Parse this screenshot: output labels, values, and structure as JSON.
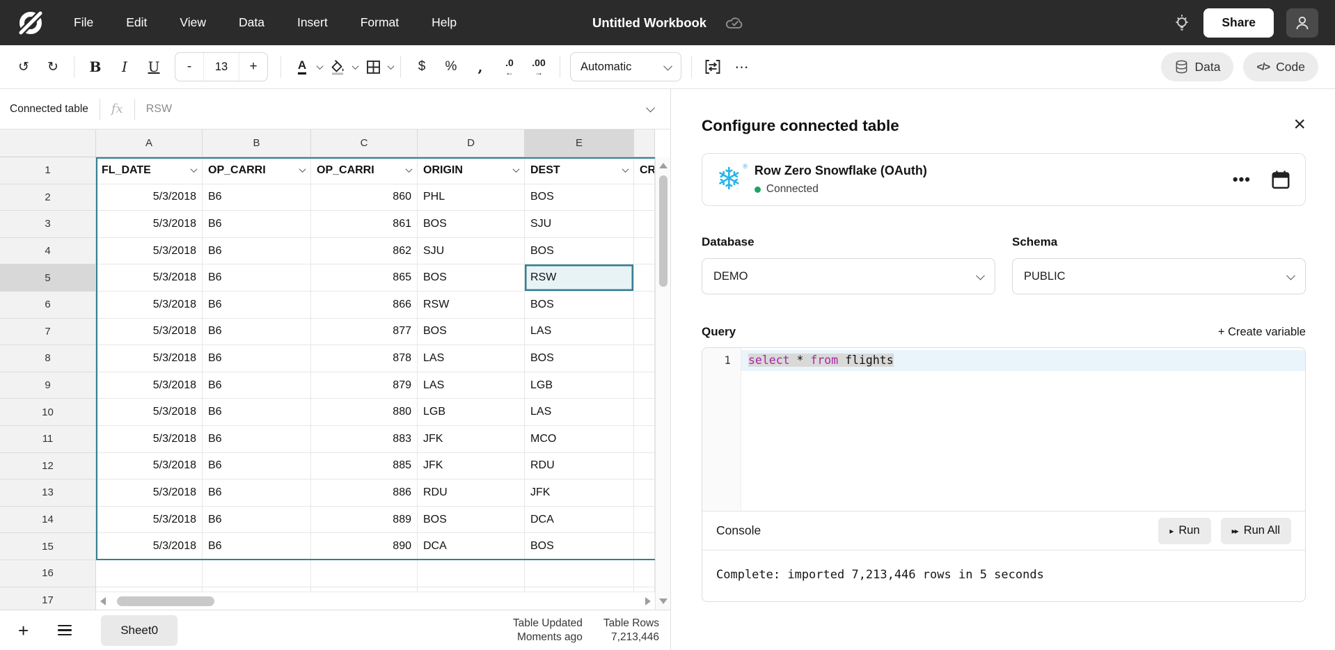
{
  "colors": {
    "topbar": "#2b2b2b",
    "accent_teal": "#337f90",
    "selected_cell_fill": "#e8f3f6",
    "snowflake_blue": "#29b5e8",
    "connected_green": "#1fa463",
    "keyword_purple": "#a626a4"
  },
  "menubar": {
    "items": [
      "File",
      "Edit",
      "View",
      "Data",
      "Insert",
      "Format",
      "Help"
    ],
    "title": "Untitled Workbook",
    "share_label": "Share"
  },
  "toolbar": {
    "undo": "↺",
    "redo": "↻",
    "bold": "B",
    "italic": "I",
    "underline": "U",
    "size_minus": "-",
    "font_size": "13",
    "size_plus": "+",
    "text_color": "A",
    "currency": "$",
    "percent": "%",
    "comma": ",",
    "dec_decrease": ".0",
    "dec_decrease_arrow": "←",
    "dec_increase": ".00",
    "dec_increase_arrow": "→",
    "number_format": "Automatic",
    "more": "⋯",
    "data_label": "Data",
    "code_glyph": "</>",
    "code_label": "Code"
  },
  "formula_bar": {
    "name_box": "Connected table",
    "fx": "fx",
    "value": "RSW"
  },
  "grid": {
    "column_letters": [
      "A",
      "B",
      "C",
      "D",
      "E",
      ""
    ],
    "header_row": [
      "FL_DATE",
      "OP_CARRI",
      "OP_CARRI",
      "ORIGIN",
      "DEST",
      "CR"
    ],
    "row_numbers": [
      "1",
      "2",
      "3",
      "4",
      "5",
      "6",
      "7",
      "8",
      "9",
      "10",
      "11",
      "12",
      "13",
      "14",
      "15",
      "16",
      "17"
    ],
    "rows": [
      [
        "5/3/2018",
        "B6",
        "860",
        "PHL",
        "BOS"
      ],
      [
        "5/3/2018",
        "B6",
        "861",
        "BOS",
        "SJU"
      ],
      [
        "5/3/2018",
        "B6",
        "862",
        "SJU",
        "BOS"
      ],
      [
        "5/3/2018",
        "B6",
        "865",
        "BOS",
        "RSW"
      ],
      [
        "5/3/2018",
        "B6",
        "866",
        "RSW",
        "BOS"
      ],
      [
        "5/3/2018",
        "B6",
        "877",
        "BOS",
        "LAS"
      ],
      [
        "5/3/2018",
        "B6",
        "878",
        "LAS",
        "BOS"
      ],
      [
        "5/3/2018",
        "B6",
        "879",
        "LAS",
        "LGB"
      ],
      [
        "5/3/2018",
        "B6",
        "880",
        "LGB",
        "LAS"
      ],
      [
        "5/3/2018",
        "B6",
        "883",
        "JFK",
        "MCO"
      ],
      [
        "5/3/2018",
        "B6",
        "885",
        "JFK",
        "RDU"
      ],
      [
        "5/3/2018",
        "B6",
        "886",
        "RDU",
        "JFK"
      ],
      [
        "5/3/2018",
        "B6",
        "889",
        "BOS",
        "DCA"
      ],
      [
        "5/3/2018",
        "B6",
        "890",
        "DCA",
        "BOS"
      ]
    ],
    "selected": {
      "row": "5",
      "column": "E",
      "value": "RSW"
    }
  },
  "status_bar": {
    "add_sheet": "+",
    "sheet_tab": "Sheet0",
    "updated_label": "Table Updated",
    "updated_value": "Moments ago",
    "rows_label": "Table Rows",
    "rows_value": "7,213,446"
  },
  "panel": {
    "title": "Configure connected table",
    "close_icon": "×",
    "connection": {
      "snowflake_glyph": "❄",
      "registered": "®",
      "name": "Row Zero Snowflake (OAuth)",
      "status": "Connected",
      "more": "•••"
    },
    "database_label": "Database",
    "database_value": "DEMO",
    "schema_label": "Schema",
    "schema_value": "PUBLIC",
    "query_label": "Query",
    "create_variable": "+  Create variable",
    "editor": {
      "line_number": "1",
      "tokens": [
        {
          "t": "select",
          "k": true
        },
        {
          "t": " * ",
          "k": false
        },
        {
          "t": "from",
          "k": true
        },
        {
          "t": " flights",
          "k": false
        }
      ]
    },
    "console": {
      "label": "Console",
      "run_icon": "▸",
      "run_label": "Run",
      "run_all_icon": "▸▸",
      "run_all_label": "Run All"
    },
    "message": "Complete: imported 7,213,446 rows in 5 seconds"
  }
}
